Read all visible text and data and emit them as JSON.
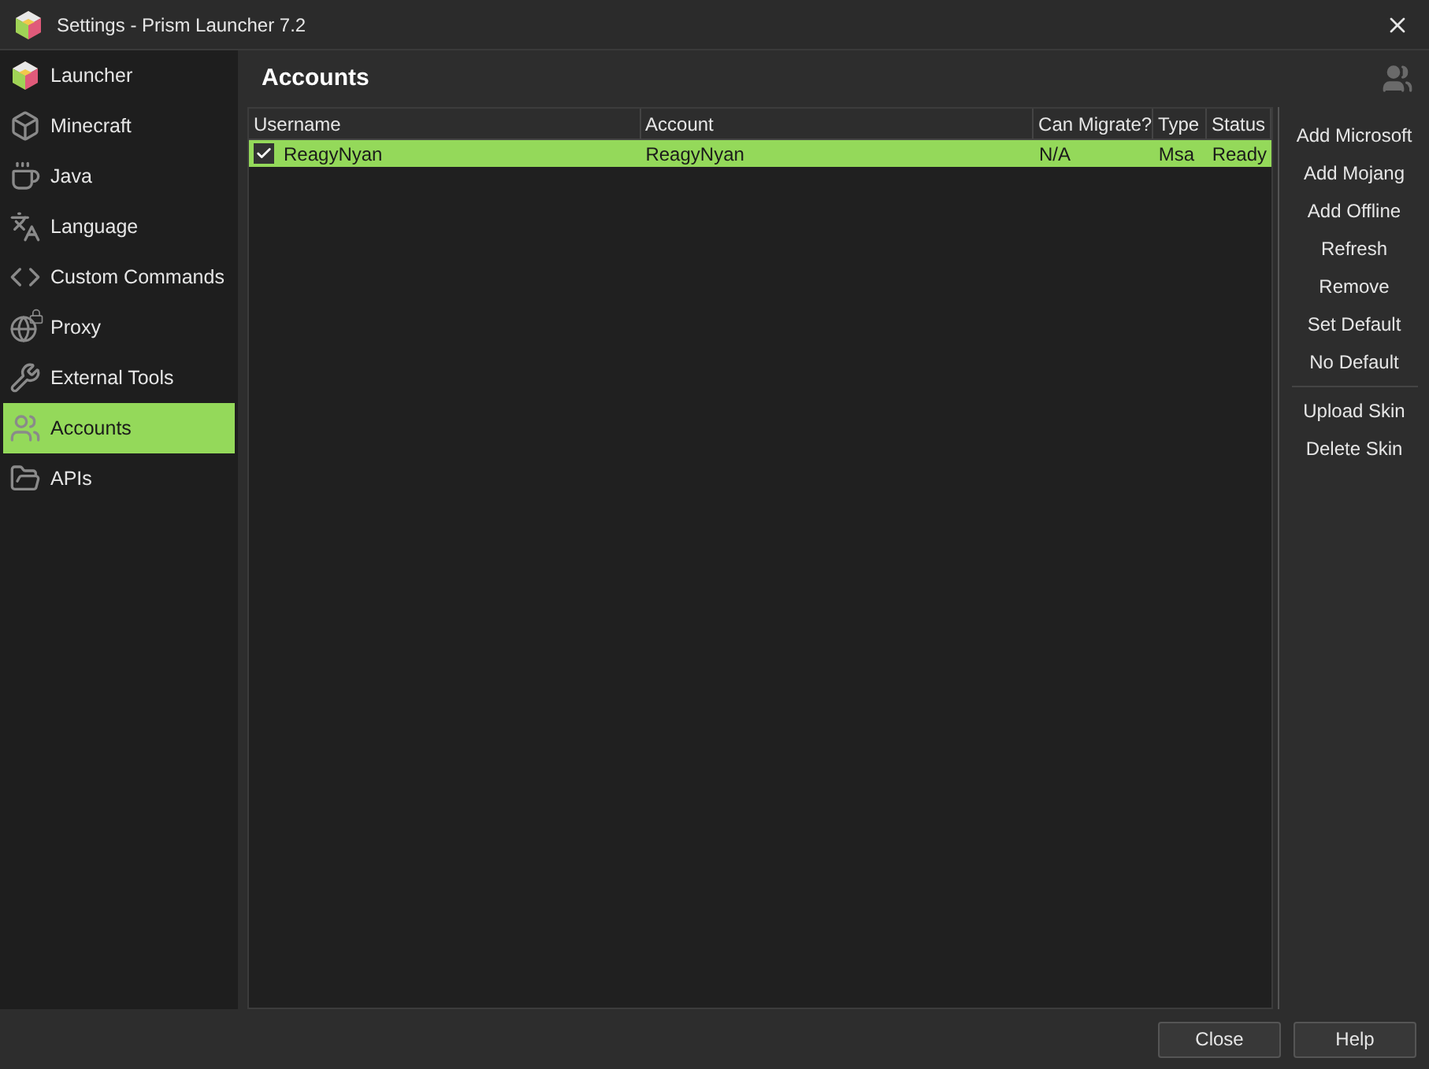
{
  "window": {
    "title": "Settings - Prism Launcher 7.2"
  },
  "sidebar": {
    "items": [
      {
        "label": "Launcher",
        "selected": false
      },
      {
        "label": "Minecraft",
        "selected": false
      },
      {
        "label": "Java",
        "selected": false
      },
      {
        "label": "Language",
        "selected": false
      },
      {
        "label": "Custom Commands",
        "selected": false
      },
      {
        "label": "Proxy",
        "selected": false
      },
      {
        "label": "External Tools",
        "selected": false
      },
      {
        "label": "Accounts",
        "selected": true
      },
      {
        "label": "APIs",
        "selected": false
      }
    ]
  },
  "page": {
    "title": "Accounts"
  },
  "table": {
    "columns": [
      "Username",
      "Account",
      "Can Migrate?",
      "Type",
      "Status"
    ],
    "rows": [
      {
        "checked": true,
        "selected": true,
        "cells": [
          "ReagyNyan",
          "ReagyNyan",
          "N/A",
          "Msa",
          "Ready"
        ]
      }
    ]
  },
  "actions": [
    {
      "label": "Add Microsoft",
      "kind": "button"
    },
    {
      "label": "Add Mojang",
      "kind": "button"
    },
    {
      "label": "Add Offline",
      "kind": "button"
    },
    {
      "label": "Refresh",
      "kind": "button"
    },
    {
      "label": "Remove",
      "kind": "button"
    },
    {
      "label": "Set Default",
      "kind": "button"
    },
    {
      "label": "No Default",
      "kind": "button"
    },
    {
      "kind": "separator"
    },
    {
      "label": "Upload Skin",
      "kind": "button"
    },
    {
      "label": "Delete Skin",
      "kind": "button"
    }
  ],
  "footer": {
    "buttons": [
      "Close",
      "Help"
    ]
  }
}
